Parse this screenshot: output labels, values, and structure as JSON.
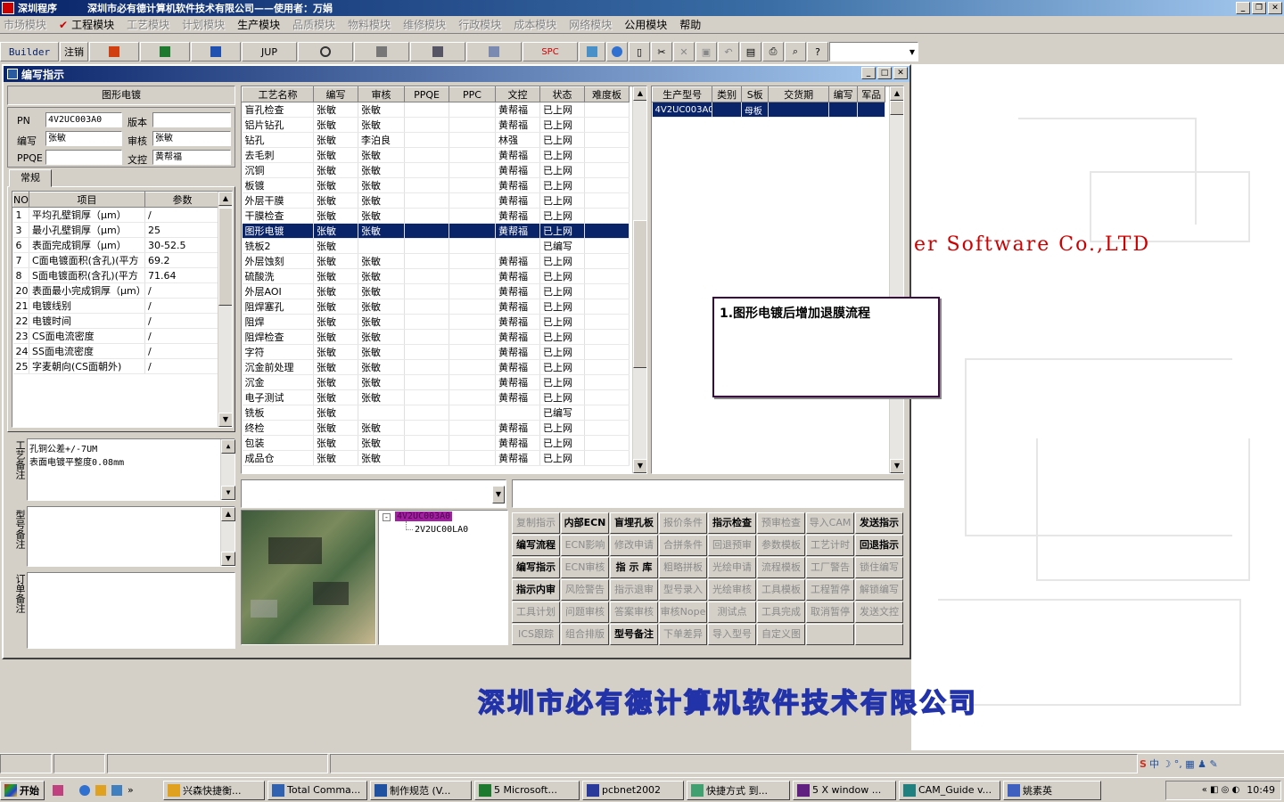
{
  "app": {
    "title": "深圳程序",
    "company_title": "深圳市必有德计算机软件技术有限公司——使用者：万娟"
  },
  "menu": [
    {
      "label": "市场模块",
      "enabled": false
    },
    {
      "label": "工程模块",
      "enabled": true,
      "checked": true
    },
    {
      "label": "工艺模块",
      "enabled": false
    },
    {
      "label": "计划模块",
      "enabled": false
    },
    {
      "label": "生产模块",
      "enabled": true
    },
    {
      "label": "品质模块",
      "enabled": false
    },
    {
      "label": "物料模块",
      "enabled": false
    },
    {
      "label": "维修模块",
      "enabled": false
    },
    {
      "label": "行政模块",
      "enabled": false
    },
    {
      "label": "成本模块",
      "enabled": false
    },
    {
      "label": "网络模块",
      "enabled": false
    },
    {
      "label": "公用模块",
      "enabled": true
    },
    {
      "label": "帮助",
      "enabled": true
    }
  ],
  "toolbar": {
    "builder": "Builder",
    "logout": "注销",
    "jup": "JUP",
    "spc": "SPC"
  },
  "child": {
    "title": "编写指示"
  },
  "left": {
    "section_title": "图形电镀",
    "pn_label": "PN",
    "pn_value": "4V2UC003A0",
    "version_label": "版本",
    "version_value": "",
    "writer_label": "编写",
    "writer_value": "张敏",
    "audit_label": "审核",
    "audit_value": "张敏",
    "ppqe_label": "PPQE",
    "ppqe_value": "",
    "wk_label": "文控",
    "wk_value": "黄帮福",
    "tab": "常规",
    "params_headers": [
      "NO",
      "项目",
      "参数"
    ],
    "params": [
      [
        "1",
        "平均孔壁铜厚（μm）",
        "/"
      ],
      [
        "3",
        "最小孔壁铜厚（μm）",
        "25"
      ],
      [
        "6",
        "表面完成铜厚（μm）",
        "30-52.5"
      ],
      [
        "7",
        "C面电镀面积(含孔)(平方",
        "69.2"
      ],
      [
        "8",
        "S面电镀面积(含孔)(平方",
        "71.64"
      ],
      [
        "20",
        "表面最小完成铜厚（μm）",
        "/"
      ],
      [
        "21",
        "电镀线别",
        "/"
      ],
      [
        "22",
        "电镀时间",
        "/"
      ],
      [
        "23",
        "CS面电流密度",
        "/"
      ],
      [
        "24",
        "SS面电流密度",
        "/"
      ],
      [
        "25",
        "字麦朝向(CS面朝外)",
        "/"
      ]
    ],
    "proc_note_label": "工艺备注",
    "proc_note_lines": [
      "孔铜公差+/-7UM",
      "表面电镀平整度0.08mm"
    ],
    "model_note_label": "型号备注",
    "order_note_label": "订单备注"
  },
  "process": {
    "headers": [
      "工艺名称",
      "编写",
      "审核",
      "PPQE",
      "PPC",
      "文控",
      "状态",
      "难度板"
    ],
    "rows": [
      [
        "盲孔检查",
        "张敏",
        "张敏",
        "",
        "",
        "黄帮福",
        "已上网"
      ],
      [
        "铝片钻孔",
        "张敏",
        "张敏",
        "",
        "",
        "黄帮福",
        "已上网"
      ],
      [
        "钻孔",
        "张敏",
        "李泊良",
        "",
        "",
        "林强",
        "已上网"
      ],
      [
        "去毛刺",
        "张敏",
        "张敏",
        "",
        "",
        "黄帮福",
        "已上网"
      ],
      [
        "沉铜",
        "张敏",
        "张敏",
        "",
        "",
        "黄帮福",
        "已上网"
      ],
      [
        "板镀",
        "张敏",
        "张敏",
        "",
        "",
        "黄帮福",
        "已上网"
      ],
      [
        "外层干膜",
        "张敏",
        "张敏",
        "",
        "",
        "黄帮福",
        "已上网"
      ],
      [
        "干膜检查",
        "张敏",
        "张敏",
        "",
        "",
        "黄帮福",
        "已上网"
      ],
      [
        "图形电镀",
        "张敏",
        "张敏",
        "",
        "",
        "黄帮福",
        "已上网"
      ],
      [
        "铣板2",
        "张敏",
        "",
        "",
        "",
        "",
        "已编写"
      ],
      [
        "外层蚀刻",
        "张敏",
        "张敏",
        "",
        "",
        "黄帮福",
        "已上网"
      ],
      [
        "硫酸洗",
        "张敏",
        "张敏",
        "",
        "",
        "黄帮福",
        "已上网"
      ],
      [
        "外层AOI",
        "张敏",
        "张敏",
        "",
        "",
        "黄帮福",
        "已上网"
      ],
      [
        "阻焊塞孔",
        "张敏",
        "张敏",
        "",
        "",
        "黄帮福",
        "已上网"
      ],
      [
        "阻焊",
        "张敏",
        "张敏",
        "",
        "",
        "黄帮福",
        "已上网"
      ],
      [
        "阻焊检查",
        "张敏",
        "张敏",
        "",
        "",
        "黄帮福",
        "已上网"
      ],
      [
        "字符",
        "张敏",
        "张敏",
        "",
        "",
        "黄帮福",
        "已上网"
      ],
      [
        "沉金前处理",
        "张敏",
        "张敏",
        "",
        "",
        "黄帮福",
        "已上网"
      ],
      [
        "沉金",
        "张敏",
        "张敏",
        "",
        "",
        "黄帮福",
        "已上网"
      ],
      [
        "电子测试",
        "张敏",
        "张敏",
        "",
        "",
        "黄帮福",
        "已上网"
      ],
      [
        "铣板",
        "张敏",
        "",
        "",
        "",
        "",
        "已编写"
      ],
      [
        "终检",
        "张敏",
        "张敏",
        "",
        "",
        "黄帮福",
        "已上网"
      ],
      [
        "包装",
        "张敏",
        "张敏",
        "",
        "",
        "黄帮福",
        "已上网"
      ],
      [
        "成品仓",
        "张敏",
        "张敏",
        "",
        "",
        "黄帮福",
        "已上网"
      ]
    ],
    "selected_index": 8
  },
  "production": {
    "headers": [
      "生产型号",
      "类别",
      "S板",
      "交货期",
      "编写",
      "军品"
    ],
    "rows": [
      [
        "4V2UC003A0",
        "",
        "母板",
        "",
        "",
        ""
      ]
    ]
  },
  "tree": {
    "root": "4V2UC003A0",
    "child": "2V2UC00LA0"
  },
  "buttons": [
    [
      [
        "复制指示",
        false
      ],
      [
        "内部ECN",
        true
      ],
      [
        "盲埋孔板",
        true
      ],
      [
        "报价条件",
        false
      ],
      [
        "指示检查",
        true
      ],
      [
        "预审检查",
        false
      ],
      [
        "导入CAM",
        false
      ],
      [
        "发送指示",
        true
      ]
    ],
    [
      [
        "编写流程",
        true
      ],
      [
        "ECN影响",
        false
      ],
      [
        "修改申请",
        false
      ],
      [
        "合拼条件",
        false
      ],
      [
        "回退预审",
        false
      ],
      [
        "参数模板",
        false
      ],
      [
        "工艺计时",
        false
      ],
      [
        "回退指示",
        true
      ]
    ],
    [
      [
        "编写指示",
        true
      ],
      [
        "ECN审核",
        false
      ],
      [
        "指 示 库",
        true
      ],
      [
        "粗略拼板",
        false
      ],
      [
        "光绘申请",
        false
      ],
      [
        "流程模板",
        false
      ],
      [
        "工厂警告",
        false
      ],
      [
        "锁住编写",
        false
      ]
    ],
    [
      [
        "指示内审",
        true
      ],
      [
        "风险警告",
        false
      ],
      [
        "指示退审",
        false
      ],
      [
        "型号录入",
        false
      ],
      [
        "光绘审核",
        false
      ],
      [
        "工具模板",
        false
      ],
      [
        "工程暂停",
        false
      ],
      [
        "解锁编写",
        false
      ]
    ],
    [
      [
        "工具计划",
        false
      ],
      [
        "问题审核",
        false
      ],
      [
        "答案审核",
        false
      ],
      [
        "审核Nope",
        false
      ],
      [
        "测试点",
        false
      ],
      [
        "工具完成",
        false
      ],
      [
        "取消暂停",
        false
      ],
      [
        "发送文控",
        false
      ]
    ],
    [
      [
        "ICS跟踪",
        false
      ],
      [
        "组合排版",
        false
      ],
      [
        "型号备注",
        true
      ],
      [
        "下单差异",
        false
      ],
      [
        "导入型号",
        false
      ],
      [
        "自定义图",
        false
      ],
      [
        "",
        false
      ],
      [
        "",
        false
      ]
    ]
  ],
  "annotation": "1.图形电镀后增加退膜流程",
  "background": {
    "software_text": "er Software Co.,LTD",
    "company_text": "深圳市必有德计算机软件技术有限公司"
  },
  "taskbar": {
    "start": "开始",
    "items": [
      "兴森快捷衡...",
      "Total Comma...",
      "制作规范 (V...",
      "5 Microsoft...",
      "pcbnet2002",
      "快捷方式 到...",
      "5 X window ...",
      "CAM_Guide v...",
      "姚素英"
    ],
    "clock": "10:49"
  },
  "colors": {
    "titlebar": "#0a246a",
    "selection": "#0a246a",
    "brand_red": "#cc0000",
    "annotation_border": "#3a0a40"
  }
}
